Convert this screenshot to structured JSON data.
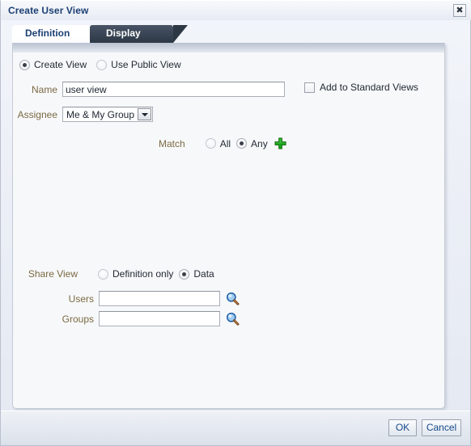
{
  "dialog": {
    "title": "Create User View",
    "close_icon": "close-icon"
  },
  "tabs": [
    {
      "label": "Definition",
      "active": true
    },
    {
      "label": "Display",
      "active": false
    }
  ],
  "form": {
    "view_source": {
      "options": [
        {
          "label": "Create View",
          "selected": true
        },
        {
          "label": "Use Public View",
          "selected": false
        }
      ]
    },
    "name": {
      "label": "Name",
      "value": "user view",
      "placeholder": ""
    },
    "add_to_standard_views": {
      "label": "Add to Standard Views",
      "checked": false
    },
    "assignee": {
      "label": "Assignee",
      "value": "Me & My Group",
      "arrow_icon": "chevron-down-icon"
    },
    "match": {
      "label": "Match",
      "options": [
        {
          "label": "All",
          "selected": false
        },
        {
          "label": "Any",
          "selected": true
        }
      ],
      "add_icon": "plus-icon"
    },
    "share_view": {
      "label": "Share View",
      "options": [
        {
          "label": "Definition only",
          "selected": false
        },
        {
          "label": "Data",
          "selected": true
        }
      ]
    },
    "users": {
      "label": "Users",
      "value": "",
      "placeholder": "",
      "search_icon": "search-icon"
    },
    "groups": {
      "label": "Groups",
      "value": "",
      "placeholder": "",
      "search_icon": "search-icon"
    }
  },
  "footer": {
    "ok_label": "OK",
    "cancel_label": "Cancel"
  },
  "colors": {
    "title_text": "#1b3f73",
    "field_label": "#7a6a42",
    "button_text": "#174a8b",
    "tab_active_text": "#1b3f73",
    "tab_inactive_bg": "#2d3845",
    "plus_icon": "#19a319",
    "search_icon_lens": "#6ba7e0"
  }
}
